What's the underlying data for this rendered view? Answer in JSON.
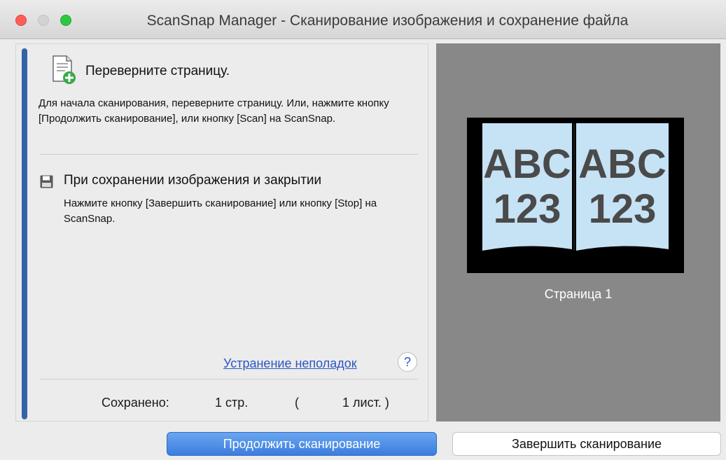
{
  "window": {
    "title": "ScanSnap Manager - Сканирование изображения и сохранение файла"
  },
  "instructions": {
    "turn_page_heading": "Переверните страницу.",
    "turn_page_text": "Для начала сканирования, переверните страницу. Или, нажмите кнопку [Продолжить сканирование], или кнопку [Scan] на ScanSnap.",
    "save_close_heading": "При сохранении изображения и закрытии",
    "save_close_text": "Нажмите кнопку [Завершить сканирование] или кнопку [Stop] на ScanSnap.",
    "doc_icon": "document-add-icon",
    "save_icon": "floppy-disk-icon"
  },
  "help": {
    "troubleshooting_link": "Устранение неполадок",
    "help_symbol": "?"
  },
  "status": {
    "saved_label": "Сохранено:",
    "pages": "1 стр.",
    "paren_open": "(",
    "sheets": "1 лист. )"
  },
  "preview": {
    "page_text_left_line1": "ABC",
    "page_text_left_line2": "123",
    "page_text_right_line1": "ABC",
    "page_text_right_line2": "123",
    "caption": "Страница 1"
  },
  "buttons": {
    "continue_label": "Продолжить сканирование",
    "finish_label": "Завершить сканирование"
  },
  "colors": {
    "accent": "#3464a8",
    "primary_button": "#3b7de0",
    "preview_bg": "#888888",
    "page_paper": "#c6e2f5",
    "link": "#2b56c4"
  }
}
